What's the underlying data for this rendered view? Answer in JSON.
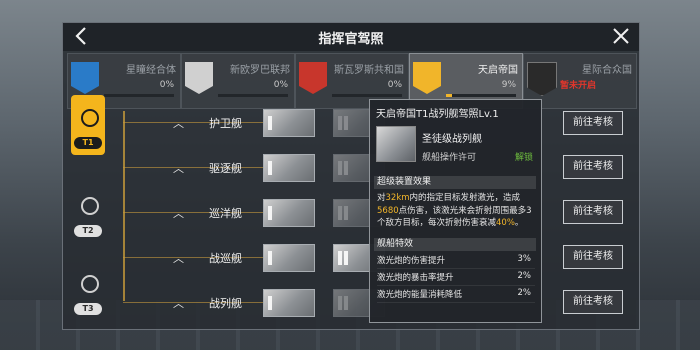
{
  "window": {
    "title": "指挥官驾照"
  },
  "factions": [
    {
      "name": "星瞳经合体",
      "pct": "0%",
      "emblem_color": "#2a7bc8",
      "progress": 0,
      "active": false
    },
    {
      "name": "新欧罗巴联邦",
      "pct": "0%",
      "emblem_color": "#d0d0d0",
      "progress": 0,
      "active": false
    },
    {
      "name": "斯瓦罗斯共和国",
      "pct": "0%",
      "emblem_color": "#c8362c",
      "progress": 0,
      "active": false
    },
    {
      "name": "天启帝国",
      "pct": "9%",
      "emblem_color": "#f1b52a",
      "progress": 0.09,
      "active": true
    },
    {
      "name": "星际合众国",
      "locked_text": "暂未开启",
      "emblem_color": "#2a2a2a",
      "active": false
    }
  ],
  "tiers": [
    "T1",
    "T2",
    "T3"
  ],
  "ships": [
    {
      "name": "护卫舰",
      "button": "前往考核"
    },
    {
      "name": "驱逐舰",
      "button": "前往考核"
    },
    {
      "name": "巡洋舰",
      "button": "前往考核"
    },
    {
      "name": "战巡舰",
      "button": "前往考核"
    },
    {
      "name": "战列舰",
      "button": "前往考核"
    }
  ],
  "popup": {
    "title": "天启帝国T1战列舰驾照Lv.1",
    "ship_name": "圣徒级战列舰",
    "license_label": "舰船操作许可",
    "unlock_status": "解锁",
    "section_super": "超级装置效果",
    "desc_parts": [
      "对",
      "32km",
      "内的指定目标发射激光，造成",
      "5680",
      "点伤害，该激光来会折射周围最多3个敌方目标，每次折射伤害衰减",
      "40%",
      "。"
    ],
    "section_features": "舰船特效",
    "features": [
      {
        "label": "激光炮的伤害提升",
        "value": "3%"
      },
      {
        "label": "激光炮的暴击率提升",
        "value": "2%"
      },
      {
        "label": "激光炮的能量消耗降低",
        "value": "2%"
      }
    ]
  },
  "colors": {
    "accent": "#f1b52a",
    "unlock": "#6fbf3e",
    "locked": "#e0362c"
  }
}
